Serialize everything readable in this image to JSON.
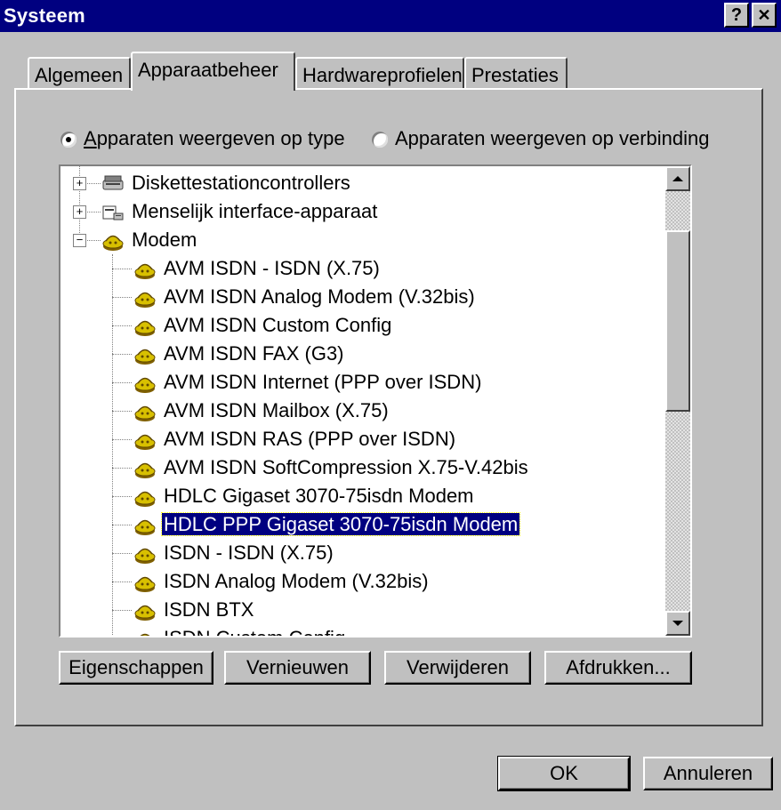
{
  "window": {
    "title": "Systeem",
    "help_glyph": "?",
    "close_glyph": "✕"
  },
  "tabs": [
    {
      "label": "Algemeen"
    },
    {
      "label": "Apparaatbeheer"
    },
    {
      "label": "Hardwareprofielen"
    },
    {
      "label": "Prestaties"
    }
  ],
  "active_tab": "Apparaatbeheer",
  "view_options": {
    "by_type_label": "Apparaten weergeven op type",
    "by_connection_label": "Apparaten weergeven op verbinding",
    "selected": "by_type"
  },
  "device_tree": [
    {
      "label": "Diskettestationcontrollers",
      "level": 0,
      "expander": "+",
      "icon": "floppy-controller-icon"
    },
    {
      "label": "Menselijk interface-apparaat",
      "level": 0,
      "expander": "+",
      "icon": "hid-icon"
    },
    {
      "label": "Modem",
      "level": 0,
      "expander": "-",
      "icon": "modem-icon"
    },
    {
      "label": "AVM ISDN - ISDN (X.75)",
      "level": 1,
      "icon": "modem-icon"
    },
    {
      "label": "AVM ISDN Analog Modem (V.32bis)",
      "level": 1,
      "icon": "modem-icon"
    },
    {
      "label": "AVM ISDN Custom Config",
      "level": 1,
      "icon": "modem-icon"
    },
    {
      "label": "AVM ISDN FAX (G3)",
      "level": 1,
      "icon": "modem-icon"
    },
    {
      "label": "AVM ISDN Internet (PPP over ISDN)",
      "level": 1,
      "icon": "modem-icon"
    },
    {
      "label": "AVM ISDN Mailbox (X.75)",
      "level": 1,
      "icon": "modem-icon"
    },
    {
      "label": "AVM ISDN RAS (PPP over ISDN)",
      "level": 1,
      "icon": "modem-icon"
    },
    {
      "label": "AVM ISDN SoftCompression X.75-V.42bis",
      "level": 1,
      "icon": "modem-icon"
    },
    {
      "label": "HDLC Gigaset 3070-75isdn Modem",
      "level": 1,
      "icon": "modem-icon"
    },
    {
      "label": "HDLC PPP Gigaset 3070-75isdn Modem",
      "level": 1,
      "icon": "modem-icon",
      "selected": true
    },
    {
      "label": "ISDN - ISDN (X.75)",
      "level": 1,
      "icon": "modem-icon"
    },
    {
      "label": "ISDN Analog Modem (V.32bis)",
      "level": 1,
      "icon": "modem-icon"
    },
    {
      "label": "ISDN BTX",
      "level": 1,
      "icon": "modem-icon"
    },
    {
      "label": "ISDN Custom Config",
      "level": 1,
      "icon": "modem-icon"
    }
  ],
  "action_buttons": {
    "properties": {
      "label": "Eigenschappen"
    },
    "refresh": {
      "label": "Vernieuwen"
    },
    "remove": {
      "label": "Verwijderen"
    },
    "print": {
      "label": "Afdrukken..."
    }
  },
  "dialog_buttons": {
    "ok": {
      "label": "OK"
    },
    "cancel": {
      "label": "Annuleren"
    }
  },
  "colors": {
    "face": "#c0c0c0",
    "title_bar": "#000080",
    "selection": "#000080",
    "modem_icon": "#d8c000"
  }
}
